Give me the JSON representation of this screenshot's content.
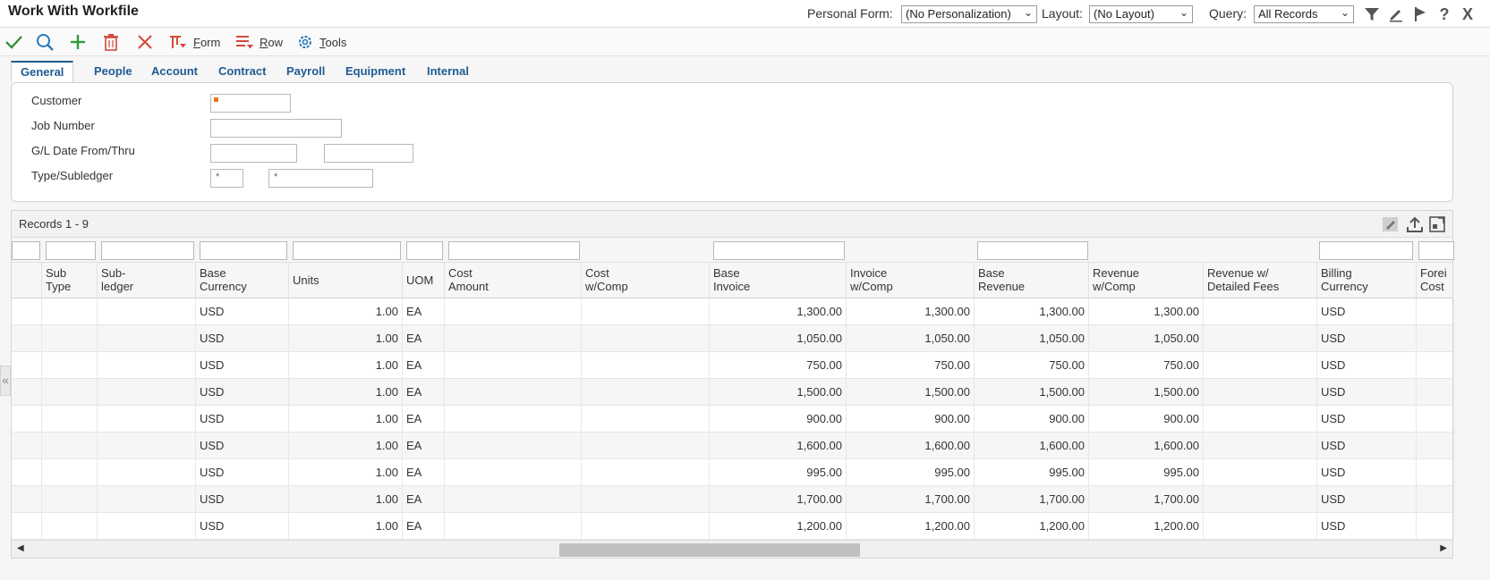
{
  "window": {
    "title": "Work With Workfile"
  },
  "header": {
    "personal_form_label": "Personal Form:",
    "personal_form_value": "(No Personalization)",
    "layout_label": "Layout:",
    "layout_value": "(No Layout)",
    "query_label": "Query:",
    "query_value": "All Records",
    "icons": [
      "filter-icon",
      "edit-icon",
      "flag-icon",
      "help-icon",
      "close-icon"
    ]
  },
  "toolbar": {
    "icons": [
      "check-icon",
      "search-icon",
      "add-icon",
      "delete-icon",
      "cancel-icon"
    ],
    "form_label_u": "F",
    "form_label_rest": "orm",
    "row_label_u": "R",
    "row_label_rest": "ow",
    "tools_label_u": "T",
    "tools_label_rest": "ools"
  },
  "tabs": [
    "General",
    "People",
    "Account",
    "Contract",
    "Payroll",
    "Equipment",
    "Internal"
  ],
  "filters": {
    "customer_label": "Customer",
    "job_number_label": "Job Number",
    "gl_date_label": "G/L Date From/Thru",
    "type_subledger_label": "Type/Subledger",
    "type_value": "*",
    "subledger_value": "*"
  },
  "grid": {
    "records_label": "Records 1 - 9",
    "columns": [
      {
        "l1": "",
        "l2": ""
      },
      {
        "l1": "Sub",
        "l2": "Type"
      },
      {
        "l1": "Sub-",
        "l2": "ledger"
      },
      {
        "l1": "Base",
        "l2": "Currency"
      },
      {
        "l1": "Units",
        "l2": ""
      },
      {
        "l1": "UOM",
        "l2": ""
      },
      {
        "l1": "Cost",
        "l2": "Amount"
      },
      {
        "l1": "Cost",
        "l2": "w/Comp"
      },
      {
        "l1": "Base",
        "l2": "Invoice"
      },
      {
        "l1": "Invoice",
        "l2": "w/Comp"
      },
      {
        "l1": "Base",
        "l2": "Revenue"
      },
      {
        "l1": "Revenue",
        "l2": "w/Comp"
      },
      {
        "l1": "Revenue w/",
        "l2": "Detailed Fees"
      },
      {
        "l1": "Billing",
        "l2": "Currency"
      },
      {
        "l1": "Forei",
        "l2": "Cost"
      }
    ],
    "rows": [
      {
        "base_currency": "USD",
        "units": "1.00",
        "uom": "EA",
        "base_invoice": "1,300.00",
        "invoice_comp": "1,300.00",
        "base_revenue": "1,300.00",
        "revenue_comp": "1,300.00",
        "billing_currency": "USD"
      },
      {
        "base_currency": "USD",
        "units": "1.00",
        "uom": "EA",
        "base_invoice": "1,050.00",
        "invoice_comp": "1,050.00",
        "base_revenue": "1,050.00",
        "revenue_comp": "1,050.00",
        "billing_currency": "USD"
      },
      {
        "base_currency": "USD",
        "units": "1.00",
        "uom": "EA",
        "base_invoice": "750.00",
        "invoice_comp": "750.00",
        "base_revenue": "750.00",
        "revenue_comp": "750.00",
        "billing_currency": "USD"
      },
      {
        "base_currency": "USD",
        "units": "1.00",
        "uom": "EA",
        "base_invoice": "1,500.00",
        "invoice_comp": "1,500.00",
        "base_revenue": "1,500.00",
        "revenue_comp": "1,500.00",
        "billing_currency": "USD"
      },
      {
        "base_currency": "USD",
        "units": "1.00",
        "uom": "EA",
        "base_invoice": "900.00",
        "invoice_comp": "900.00",
        "base_revenue": "900.00",
        "revenue_comp": "900.00",
        "billing_currency": "USD"
      },
      {
        "base_currency": "USD",
        "units": "1.00",
        "uom": "EA",
        "base_invoice": "1,600.00",
        "invoice_comp": "1,600.00",
        "base_revenue": "1,600.00",
        "revenue_comp": "1,600.00",
        "billing_currency": "USD"
      },
      {
        "base_currency": "USD",
        "units": "1.00",
        "uom": "EA",
        "base_invoice": "995.00",
        "invoice_comp": "995.00",
        "base_revenue": "995.00",
        "revenue_comp": "995.00",
        "billing_currency": "USD"
      },
      {
        "base_currency": "USD",
        "units": "1.00",
        "uom": "EA",
        "base_invoice": "1,700.00",
        "invoice_comp": "1,700.00",
        "base_revenue": "1,700.00",
        "revenue_comp": "1,700.00",
        "billing_currency": "USD"
      },
      {
        "base_currency": "USD",
        "units": "1.00",
        "uom": "EA",
        "base_invoice": "1,200.00",
        "invoice_comp": "1,200.00",
        "base_revenue": "1,200.00",
        "revenue_comp": "1,200.00",
        "billing_currency": "USD"
      }
    ]
  },
  "colors": {
    "tab_text": "#1f5b93",
    "check_green": "#2e8b2e",
    "search_blue": "#2a7ab8",
    "add_green": "#2e9b3a",
    "delete_red": "#d24a3a",
    "required_marker": "#e8741c"
  }
}
